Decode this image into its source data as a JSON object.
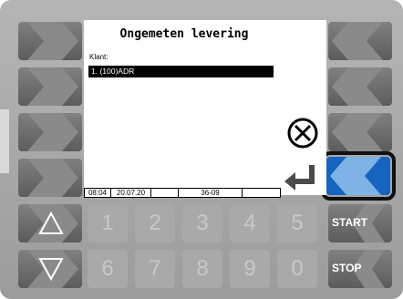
{
  "screen": {
    "title": "Ongemeten levering",
    "field_label": "Klant:",
    "selected_value": "1.  (100)ADR"
  },
  "status_bar": {
    "time": "08:04",
    "date": "20.07.20",
    "empty": "",
    "code": "36-09"
  },
  "right_keys": {
    "start_label": "START",
    "stop_label": "STOP"
  },
  "keypad": {
    "row1": [
      "1",
      "2",
      "3",
      "4",
      "5"
    ],
    "row2": [
      "6",
      "7",
      "8",
      "9",
      "0"
    ]
  },
  "colors": {
    "active_key": "#1565c0",
    "key_gray": "#6e6e6e",
    "screen_bg": "#ffffff"
  },
  "icons": {
    "cancel": "cancel-x-icon",
    "enter": "enter-arrow-icon",
    "up": "triangle-up-icon",
    "down": "triangle-down-icon"
  }
}
